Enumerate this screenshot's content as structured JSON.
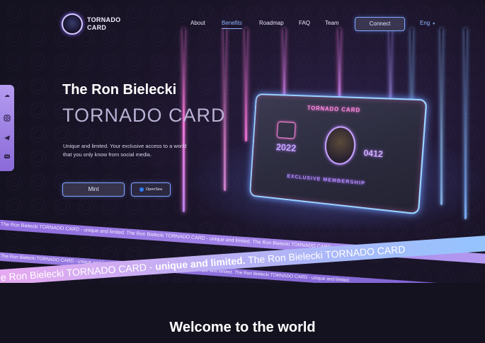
{
  "header": {
    "logo_line1": "TORNADO",
    "logo_line2": "CARD",
    "nav": [
      {
        "label": "About",
        "active": false
      },
      {
        "label": "Benefits",
        "active": true
      },
      {
        "label": "Roadmap",
        "active": false
      },
      {
        "label": "FAQ",
        "active": false
      },
      {
        "label": "Team",
        "active": false
      }
    ],
    "connect_label": "Connect",
    "language": "Eng"
  },
  "social": {
    "icons": [
      "cloud-icon",
      "instagram-icon",
      "telegram-icon",
      "discord-icon"
    ]
  },
  "hero": {
    "title": "The Ron Bielecki",
    "subtitle": "TORNADO CARD",
    "description": "Unique and limited. Your exclusive access to a world that you only know from social media.",
    "mint_label": "Mint",
    "opensea_label": "OpenSea"
  },
  "card": {
    "title": "TORNADO CARD",
    "year": "2022",
    "code": "0412",
    "membership": "EXCLUSIVE MEMBERSHIP"
  },
  "ribbons": {
    "top": "The Ron Bielecki TORNADO CARD - unique and limited. The Ron Bielecki TORNADO CARD - unique and limited. The Ron Bielecki TORNADO CARD",
    "middle_lead": "e Ron Bielecki TORNADO CARD - ",
    "middle_bold": "unique and limited.",
    "middle_tail": " The Ron Bielecki TORNADO CARD",
    "bottom": "The Ron Bielecki TORNADO CARD - unique and limited. The Ron Bielecki TORNADO CARD - unique and limited. The Ron Bielecki TORNADO CARD - unique and limited."
  },
  "section": {
    "welcome": "Welcome to the world"
  },
  "colors": {
    "accent": "#8fb4ff",
    "neon_pink": "#ff8fe0",
    "background": "#15121f"
  }
}
